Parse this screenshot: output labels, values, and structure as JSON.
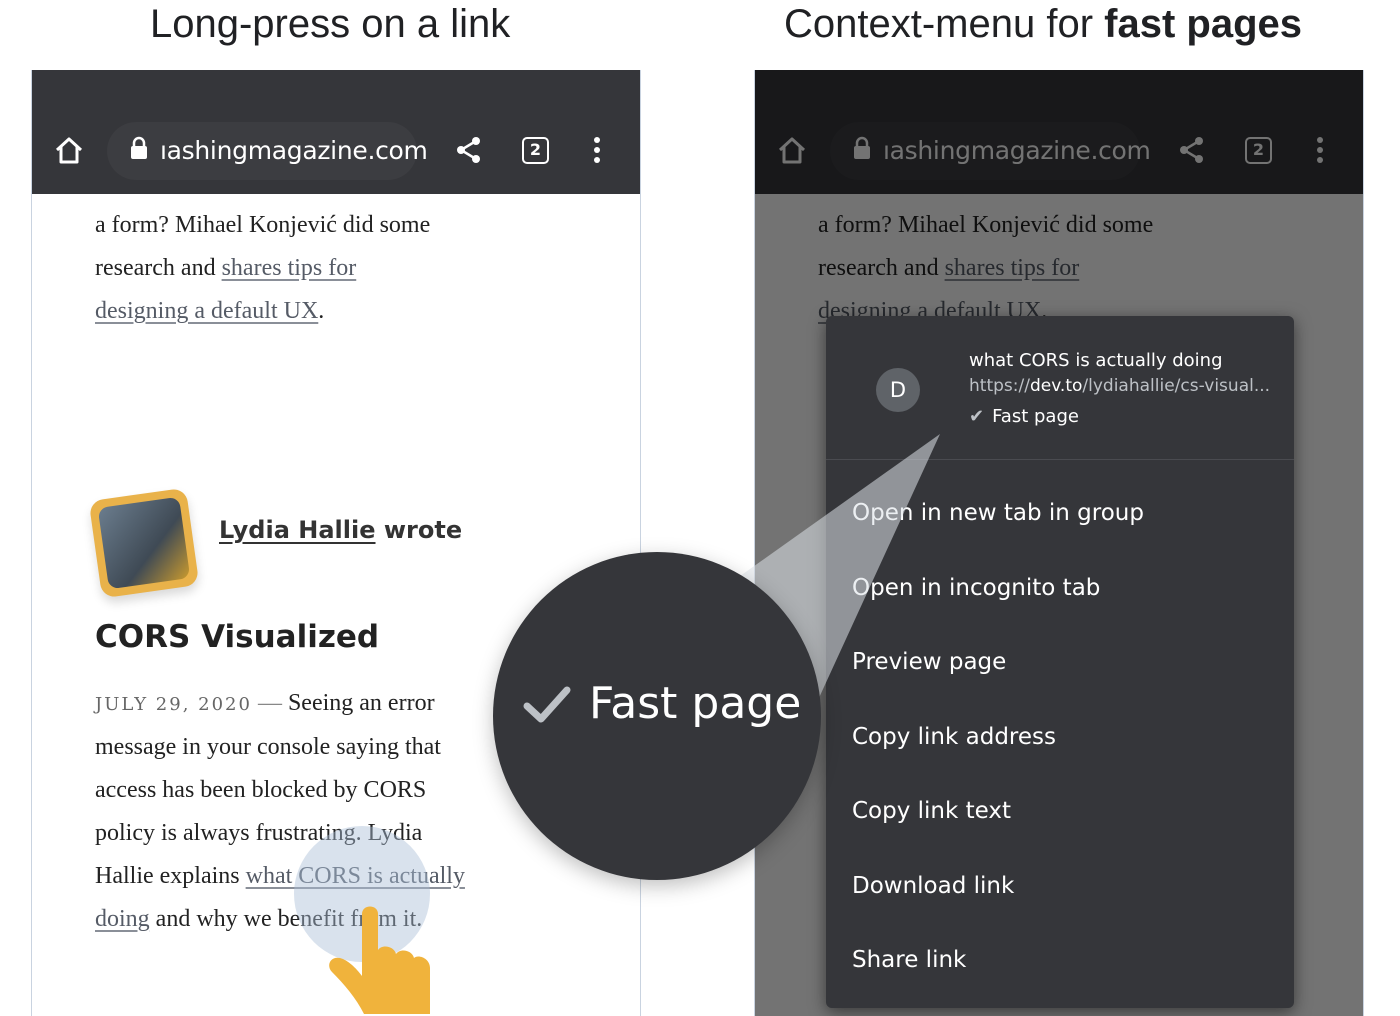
{
  "headings": {
    "left": "Long-press on a link",
    "right_prefix": "Context-menu for ",
    "right_bold": "fast pages"
  },
  "browser": {
    "url": "ıashingmagazine.com",
    "tab_count": "2"
  },
  "article": {
    "line1": "a form? Mihael Konjević did some",
    "line2_text": "research and ",
    "line2_link": "shares tips for",
    "line3_link": "designing a default UX",
    "line3_text": ".",
    "author_link": "Lydia Hallie",
    "author_suffix": " wrote",
    "post_title": "CORS Visualized",
    "date": "JULY 29, 2020",
    "dash": " — ",
    "p1": "Seeing an error",
    "p2": "message in your console saying that",
    "p3": "access has been blocked by CORS",
    "p4": "policy is always frustrating. Lydia",
    "p5_text": "Hallie explains ",
    "p5_link": "what CORS is actually",
    "p6_link": "doing",
    "p6_text": " and why we benefit from it."
  },
  "context_menu": {
    "favicon_letter": "D",
    "title": "what CORS is actually doing",
    "url_prefix": "https://",
    "url_domain": "dev.to",
    "url_path": "/lydiahallie/cs-visual...",
    "badge": "Fast page",
    "items": [
      "Open in new tab in group",
      "Open in incognito tab",
      "Preview page",
      "Copy link address",
      "Copy link text",
      "Download link",
      "Share link"
    ]
  },
  "callout": {
    "label": "Fast page"
  },
  "colors": {
    "toolbar": "#35363a",
    "menu_bg": "#35363a",
    "hand": "#f0b33c"
  }
}
